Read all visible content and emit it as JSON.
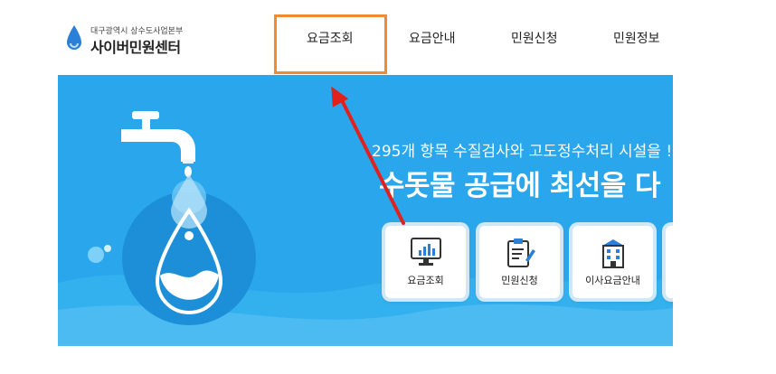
{
  "header": {
    "org_name": "대구광역시 상수도사업본부",
    "site_name": "사이버민원센터"
  },
  "nav": {
    "items": [
      {
        "label": "요금조회",
        "highlighted": true
      },
      {
        "label": "요금안내"
      },
      {
        "label": "민원신청"
      },
      {
        "label": "민원정보"
      }
    ]
  },
  "banner": {
    "line1": "295개 항목 수질검사와 고도정수처리 시설을 !",
    "line2": "수돗물 공급에 최선을 다",
    "cards": [
      {
        "label": "요금조회",
        "icon": "monitor-chart-icon"
      },
      {
        "label": "민원신청",
        "icon": "clipboard-pen-icon"
      },
      {
        "label": "이사요금안내",
        "icon": "building-icon"
      }
    ],
    "colors": {
      "background": "#2aa7ec",
      "highlight_border": "#f28a2e",
      "arrow": "#e0211c"
    }
  }
}
